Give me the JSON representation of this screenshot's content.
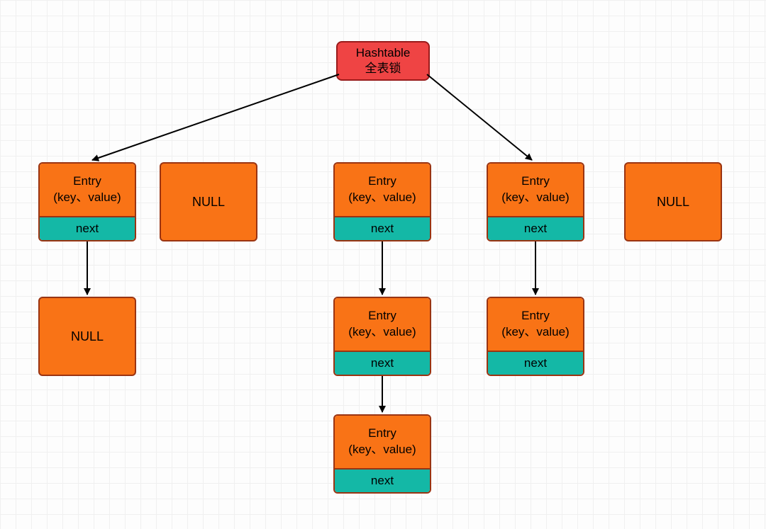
{
  "root": {
    "line1": "Hashtable",
    "line2": "全表锁"
  },
  "bucket0": {
    "title": "Entry",
    "kv": "(key、value)",
    "next": "next"
  },
  "bucket1": {
    "label": "NULL"
  },
  "bucket2": {
    "title": "Entry",
    "kv": "(key、value)",
    "next": "next"
  },
  "bucket3": {
    "title": "Entry",
    "kv": "(key、value)",
    "next": "next"
  },
  "bucket4": {
    "label": "NULL"
  },
  "chain0_1": {
    "label": "NULL"
  },
  "chain2_1": {
    "title": "Entry",
    "kv": "(key、value)",
    "next": "next"
  },
  "chain2_2": {
    "title": "Entry",
    "kv": "(key、value)",
    "next": "next"
  },
  "chain3_1": {
    "title": "Entry",
    "kv": "(key、value)",
    "next": "next"
  },
  "colors": {
    "root_bg": "#ef4444",
    "entry_bg": "#f97316",
    "next_bg": "#14b8a6",
    "border": "#9a3412"
  }
}
